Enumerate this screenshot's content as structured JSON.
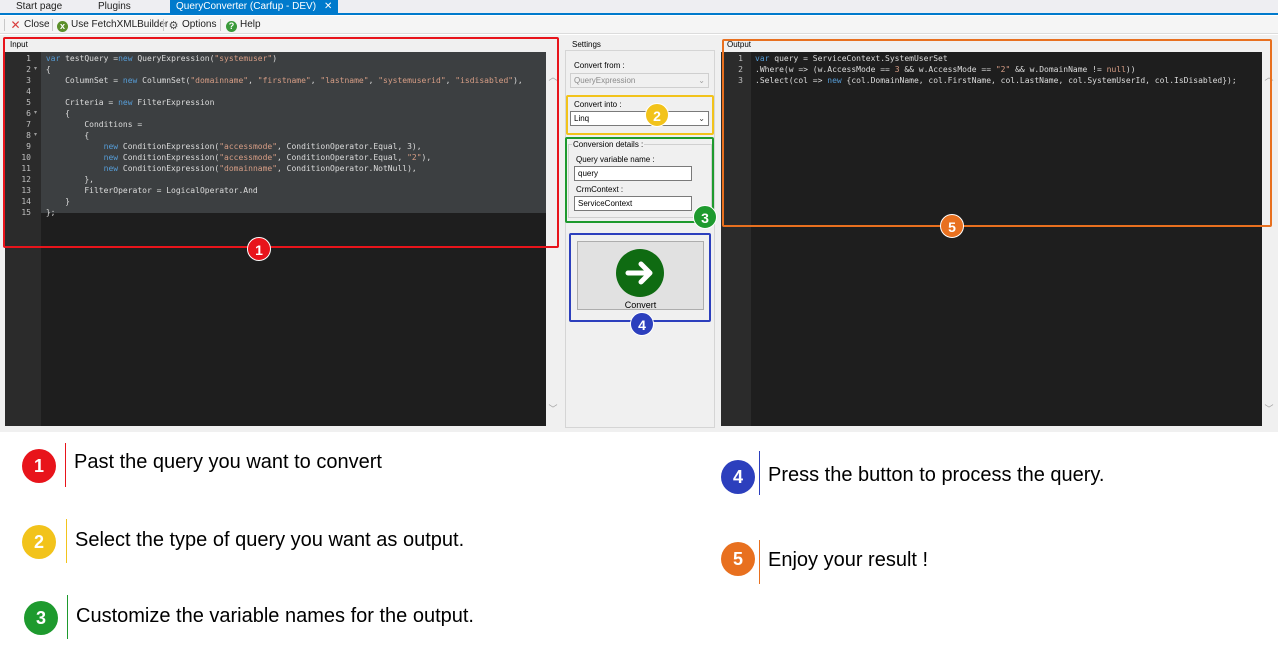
{
  "tabs": [
    {
      "label": "Start page"
    },
    {
      "label": "Plugins"
    },
    {
      "label": "QueryConverter (Carfup - DEV)",
      "close": "✕"
    }
  ],
  "toolbar": {
    "close_label": "Close",
    "fetchxml_label": "Use FetchXMLBuilder",
    "options_label": "Options",
    "help_label": "Help"
  },
  "input": {
    "group_label": "Input",
    "line_numbers": [
      "1",
      "2",
      "3",
      "4",
      "5",
      "6",
      "7",
      "8",
      "9",
      "10",
      "11",
      "12",
      "13",
      "14",
      "15"
    ]
  },
  "settings": {
    "group_label": "Settings",
    "convert_from_label": "Convert from :",
    "convert_from_value": "QueryExpression",
    "convert_into_label": "Convert into :",
    "convert_into_value": "Linq",
    "conversion_details_label": "Conversion details :",
    "query_var_label": "Query variable name :",
    "query_var_value": "query",
    "crm_context_label": "CrmContext :",
    "crm_context_value": "ServiceContext",
    "convert_button_label": "Convert"
  },
  "output": {
    "group_label": "Output",
    "line_numbers": [
      "1",
      "2",
      "3"
    ],
    "lines": [
      "var query = ServiceContext.SystemUserSet",
      ".Where(w => (w.AccessMode == 3 && w.AccessMode == \"2\" && w.DomainName != null))",
      ".Select(col => new {col.DomainName, col.FirstName, col.LastName, col.SystemUserId, col.IsDisabled});"
    ]
  },
  "annotations": {
    "colors": {
      "red": "#e8141b",
      "yellow": "#f2c31b",
      "green": "#1e9a2e",
      "blue": "#2c3fbd",
      "orange": "#e8701f"
    },
    "badges": [
      "1",
      "2",
      "3",
      "4",
      "5"
    ]
  },
  "legend": [
    {
      "number": "1",
      "text": "Past the query you want to convert"
    },
    {
      "number": "2",
      "text": "Select the type of query you want as output."
    },
    {
      "number": "3",
      "text": "Customize the variable names for the output."
    },
    {
      "number": "4",
      "text": "Press the button to process the query."
    },
    {
      "number": "5",
      "text": "Enjoy your result !"
    }
  ]
}
